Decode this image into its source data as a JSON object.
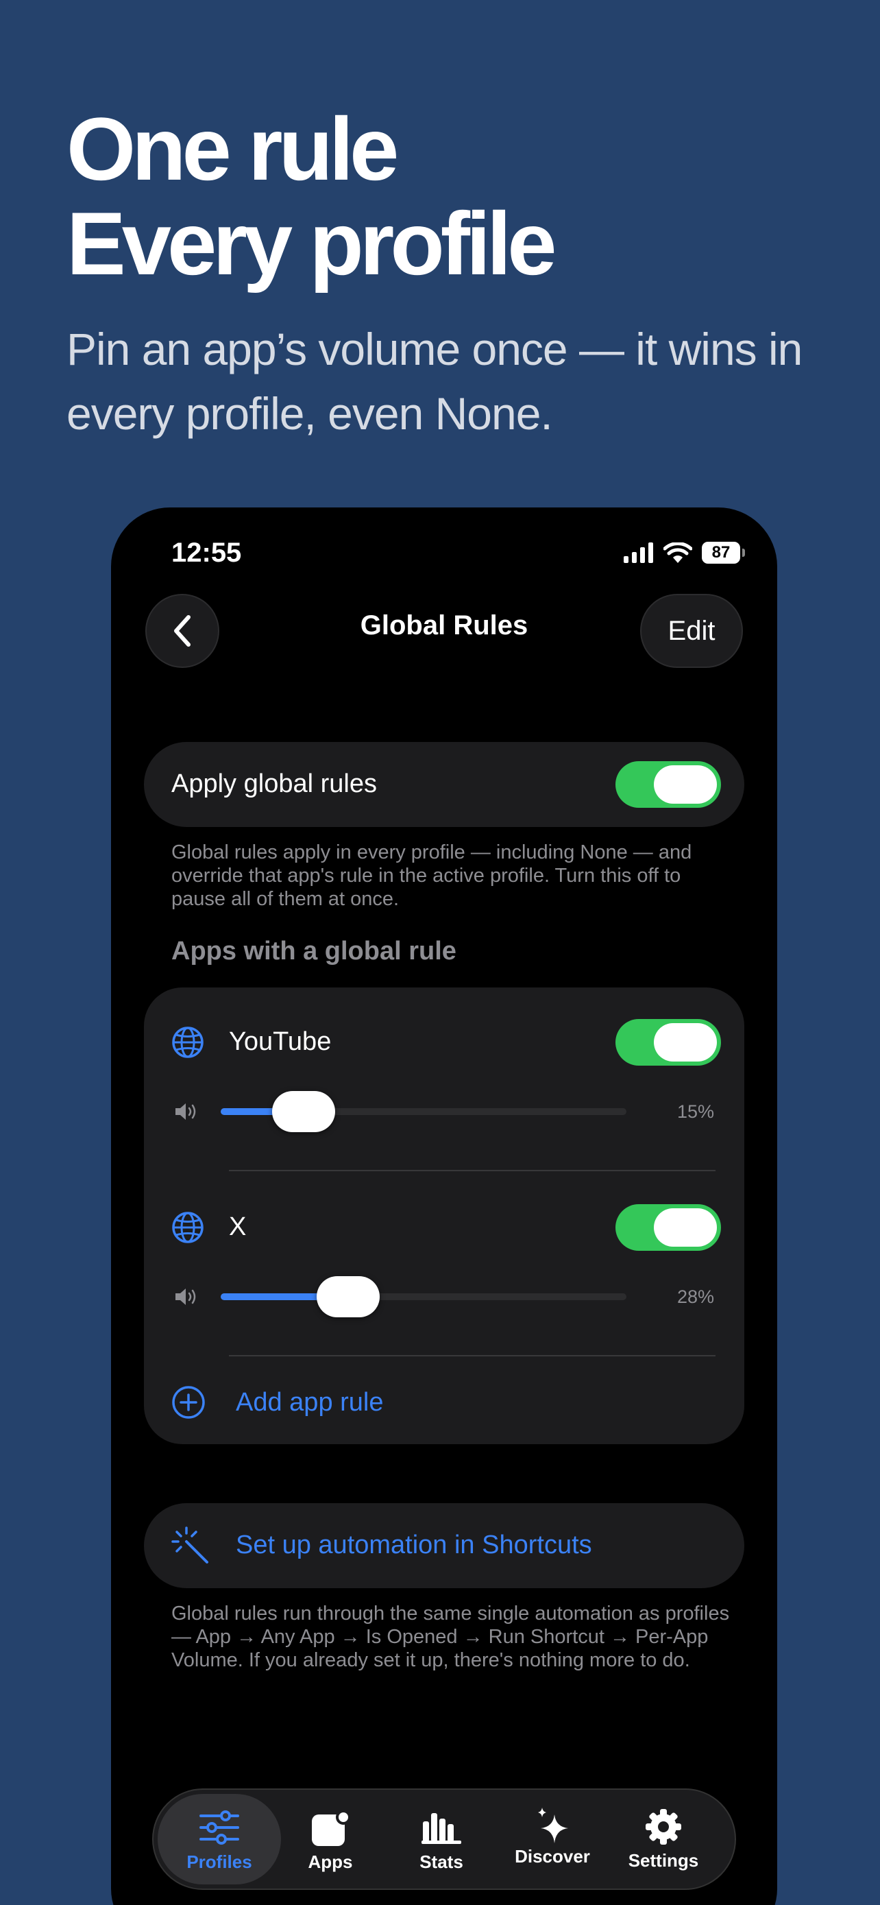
{
  "hero": {
    "title_line1": "One rule",
    "title_line2": "Every profile",
    "subtitle": "Pin an app’s volume once — it wins in every profile, even None."
  },
  "status": {
    "time": "12:55",
    "battery": "87"
  },
  "nav": {
    "title": "Global Rules",
    "edit_label": "Edit"
  },
  "apply": {
    "label": "Apply global rules",
    "enabled": true,
    "footnote": "Global rules apply in every profile — including None — and override that app's rule in the active profile. Turn this off to pause all of them at once."
  },
  "section_header": "Apps with a global rule",
  "apps": [
    {
      "name": "YouTube",
      "enabled": true,
      "volume": 15,
      "volume_label": "15%"
    },
    {
      "name": "X",
      "enabled": true,
      "volume": 28,
      "volume_label": "28%"
    }
  ],
  "add_rule_label": "Add app rule",
  "shortcuts": {
    "label": "Set up automation in Shortcuts",
    "footnote": "Global rules run through the same single automation as profiles — App → Any App → Is Opened → Run Shortcut → Per-App Volume. If you already set it up, there's nothing more to do."
  },
  "tabs": [
    {
      "label": "Profiles",
      "icon": "sliders-icon",
      "active": true
    },
    {
      "label": "Apps",
      "icon": "app-badge-icon",
      "active": false
    },
    {
      "label": "Stats",
      "icon": "bar-chart-icon",
      "active": false
    },
    {
      "label": "Discover",
      "icon": "sparkles-icon",
      "active": false
    },
    {
      "label": "Settings",
      "icon": "gear-icon",
      "active": false
    }
  ],
  "colors": {
    "background": "#25426c",
    "accent": "#3b82f6",
    "toggle_on": "#34c759"
  }
}
